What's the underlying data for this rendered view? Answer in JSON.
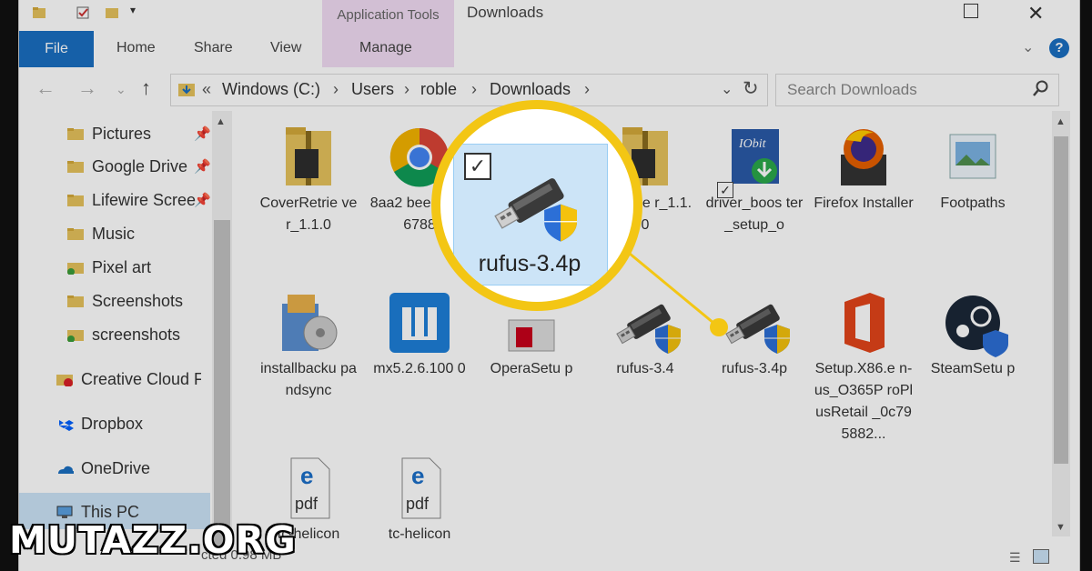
{
  "window": {
    "title": "Downloads",
    "application_tools": "Application Tools"
  },
  "ribbon": {
    "tabs": [
      "File",
      "Home",
      "Share",
      "View",
      "Manage"
    ]
  },
  "address": {
    "prefix": "«",
    "crumbs": [
      "Windows (C:)",
      "Users",
      "roble",
      "Downloads"
    ]
  },
  "search": {
    "placeholder": "Search Downloads"
  },
  "navpane": {
    "items": [
      {
        "label": "Pictures",
        "icon": "folder-pictures-icon",
        "pinned": true
      },
      {
        "label": "Google Drive",
        "icon": "folder-googledrive-icon",
        "pinned": true
      },
      {
        "label": "Lifewire Scree",
        "icon": "folder-icon",
        "pinned": true
      },
      {
        "label": "Music",
        "icon": "folder-music-icon",
        "pinned": false
      },
      {
        "label": "Pixel art",
        "icon": "folder-synced-icon",
        "pinned": false
      },
      {
        "label": "Screenshots",
        "icon": "folder-icon",
        "pinned": false
      },
      {
        "label": "screenshots",
        "icon": "folder-synced-icon",
        "pinned": false
      },
      {
        "label": "Creative Cloud File",
        "icon": "creative-cloud-icon",
        "pinned": false
      },
      {
        "label": "Dropbox",
        "icon": "dropbox-icon",
        "pinned": false
      },
      {
        "label": "OneDrive",
        "icon": "onedrive-icon",
        "pinned": false
      },
      {
        "label": "This PC",
        "icon": "computer-icon",
        "pinned": false
      }
    ]
  },
  "files": [
    {
      "name": "CoverRetrie ver_1.1.0",
      "icon": "zip-folder-icon"
    },
    {
      "name": "8aa2 bee- 99b- 6788",
      "icon": "chrome-icon"
    },
    {
      "name": "erRetrie r_1.1.0",
      "icon": "zip-folder-icon"
    },
    {
      "name": "driver_boos ter_setup_o",
      "icon": "iobit-installer-icon"
    },
    {
      "name": "Firefox Installer",
      "icon": "firefox-installer-icon"
    },
    {
      "name": "Footpaths",
      "icon": "images-folder-icon"
    },
    {
      "name": "installbacku pandsync",
      "icon": "backup-installer-icon"
    },
    {
      "name": "mx5.2.6.100 0",
      "icon": "maxthon-icon"
    },
    {
      "name": "OperaSetu p",
      "icon": "opera-installer-icon"
    },
    {
      "name": "rufus-3.4",
      "icon": "usb-drive-icon"
    },
    {
      "name": "rufus-3.4p",
      "icon": "usb-drive-icon"
    },
    {
      "name": "Setup.X86.e n-us_O365P roPlusRetail _0c795882...",
      "icon": "office-icon"
    },
    {
      "name": "SteamSetu p",
      "icon": "steam-icon"
    },
    {
      "name": "tc-helicon",
      "icon": "pdf-edge-icon"
    },
    {
      "name": "tc-helicon",
      "icon": "pdf-edge-icon"
    }
  ],
  "magnifier": {
    "label": "rufus-3.4p",
    "checked": true
  },
  "status": {
    "text": "cted  0.98 MB"
  },
  "watermark": "MUTAZZ.ORG",
  "colors": {
    "accent": "#1a6fc2",
    "selection": "#cce4f7",
    "callout": "#f3c614",
    "manage_band": "#f2dcf4"
  }
}
